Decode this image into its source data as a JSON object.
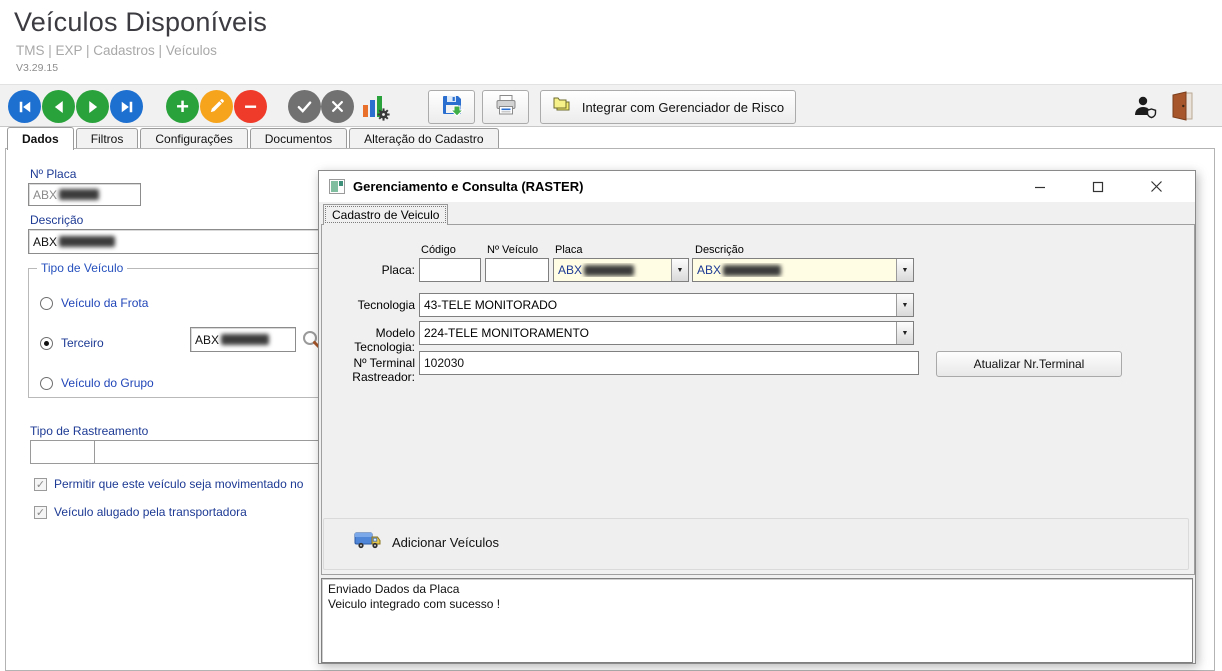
{
  "page": {
    "title": "Veículos Disponíveis",
    "breadcrumb": "TMS | EXP | Cadastros | Veículos",
    "version": "V3.29.15"
  },
  "toolbar": {
    "integrate_label": "Integrar com Gerenciador de Risco",
    "icons": [
      "first-record-icon",
      "previous-record-icon",
      "next-record-icon",
      "last-record-icon",
      "add-icon",
      "edit-icon",
      "delete-icon",
      "confirm-icon",
      "cancel-icon",
      "chart-settings-icon",
      "save-icon",
      "print-icon",
      "folders-icon",
      "user-shield-icon",
      "exit-door-icon"
    ]
  },
  "tabs": {
    "items": [
      "Dados",
      "Filtros",
      "Configurações",
      "Documentos",
      "Alteração do Cadastro"
    ],
    "active": "Dados"
  },
  "form": {
    "placa_label": "Nº Placa",
    "placa_value": "ABX",
    "descricao_label": "Descrição",
    "descricao_value": "ABX",
    "tipo_veiculo": {
      "legend": "Tipo de Veículo",
      "options": [
        "Veículo da Frota",
        "Terceiro",
        "Veículo do Grupo"
      ],
      "selected": "Terceiro",
      "terceiro_value": "ABX"
    },
    "tipo_rastreamento_label": "Tipo de Rastreamento",
    "checkboxes": [
      {
        "label": "Permitir que este veículo seja movimentado no",
        "checked": true
      },
      {
        "label": "Veículo alugado pela transportadora",
        "checked": true
      }
    ]
  },
  "dialog": {
    "title": "Gerenciamento e Consulta (RASTER)",
    "tab": "Cadastro de Veiculo",
    "window_controls": [
      "minimize",
      "maximize",
      "close"
    ],
    "fields": {
      "placa_label": "Placa:",
      "col_codigo": "Código",
      "col_nveiculo": "Nº Veículo",
      "col_placa": "Placa",
      "col_descricao": "Descrição",
      "codigo_value": "",
      "nveiculo_value": "",
      "placa_value": "ABX",
      "descricao_value": "ABX",
      "tecnologia_label": "Tecnologia",
      "tecnologia_value": "43-TELE MONITORADO",
      "modelo_label": "Modelo Tecnologia:",
      "modelo_value": "224-TELE MONITORAMENTO",
      "terminal_label": "Nº Terminal Rastreador:",
      "terminal_value": "102030",
      "atualizar_button": "Atualizar Nr.Terminal"
    },
    "adicionar_button": "Adicionar Veículos",
    "status_lines": [
      "Enviado Dados da Placa",
      "Veiculo integrado com sucesso !"
    ]
  },
  "colors": {
    "nav_blue": "#1d6fd0",
    "nav_green": "#2aa23c",
    "edit_amber": "#f7a41d",
    "delete_red": "#ef3b2a",
    "neutral_gray": "#717171",
    "label_navy": "#1d3a94",
    "combo_cream": "#fffde3",
    "door_brown": "#a6562a"
  }
}
